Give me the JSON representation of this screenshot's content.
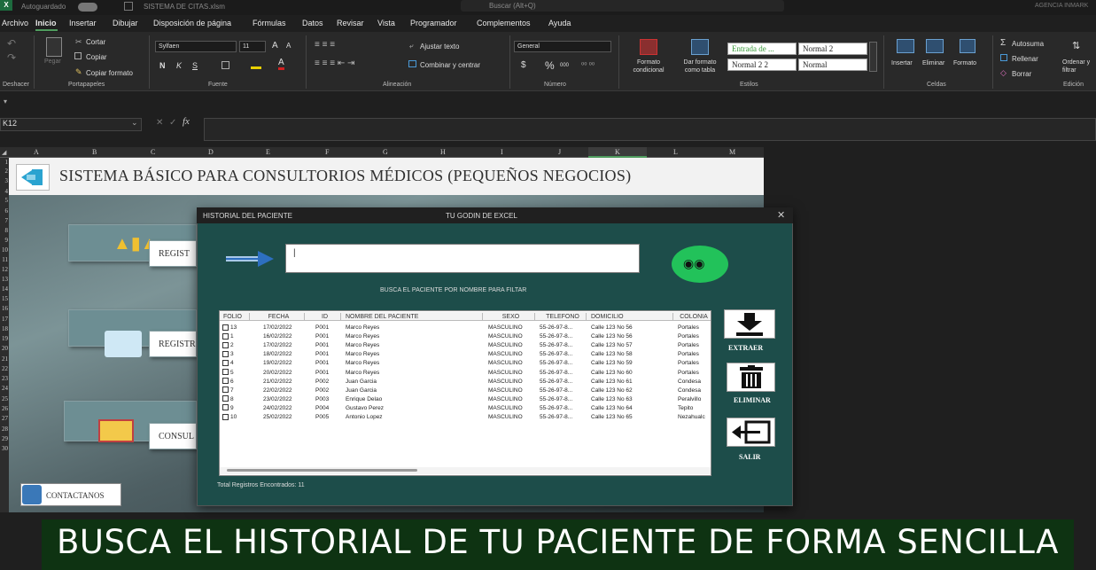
{
  "titlebar": {
    "autosave": "Autoguardado",
    "filename": "SISTEMA DE CITAS.xlsm",
    "search_placeholder": "Buscar (Alt+Q)",
    "account": "AGENCIA INMARK"
  },
  "menu": [
    "Archivo",
    "Inicio",
    "Insertar",
    "Dibujar",
    "Disposición de página",
    "Fórmulas",
    "Datos",
    "Revisar",
    "Vista",
    "Programador",
    "Complementos",
    "Ayuda"
  ],
  "ribbon": {
    "undo_group": "Deshacer",
    "clipboard": {
      "cut": "Cortar",
      "copy": "Copiar",
      "paste": "Pegar",
      "copy_format": "Copiar formato",
      "group": "Portapapeles"
    },
    "font": {
      "name": "Sylfaen",
      "size": "11",
      "bold": "N",
      "italic": "K",
      "underline": "S",
      "group": "Fuente"
    },
    "alignment": {
      "wrap": "Ajustar texto",
      "merge": "Combinar y centrar",
      "group": "Alineación"
    },
    "number": {
      "format": "General",
      "currency": "$",
      "percent": "%",
      "thousands": "000",
      "group": "Número"
    },
    "styles": {
      "cond_format": "Formato condicional",
      "as_table": "Dar formato como tabla",
      "style1": "Entrada de ...",
      "style2": "Normal 2",
      "style3": "Normal 2 2",
      "style4": "Normal",
      "group": "Estilos"
    },
    "cells": {
      "insert": "Insertar",
      "delete": "Eliminar",
      "format": "Formato",
      "group": "Celdas"
    },
    "editing": {
      "autosum": "Autosuma",
      "fill": "Rellenar",
      "clear": "Borrar",
      "sort": "Ordenar y filtrar",
      "group": "Edición"
    }
  },
  "formula_bar": {
    "cell_ref": "K12",
    "fx": "fx"
  },
  "columns": [
    "A",
    "B",
    "C",
    "D",
    "E",
    "F",
    "G",
    "H",
    "I",
    "J",
    "K",
    "L",
    "M"
  ],
  "rows": [
    "1",
    "2",
    "3",
    "4",
    "5",
    "6",
    "7",
    "8",
    "9",
    "10",
    "11",
    "12",
    "13",
    "14",
    "15",
    "16",
    "17",
    "18",
    "19",
    "20",
    "21",
    "22",
    "23",
    "24",
    "25",
    "26",
    "27",
    "28",
    "29",
    "30"
  ],
  "sheet": {
    "banner_title": "SISTEMA BÁSICO PARA CONSULTORIOS MÉDICOS (PEQUEÑOS NEGOCIOS)",
    "btn1": "REGIST",
    "btn2": "REGISTR",
    "btn3": "CONSUL",
    "contact": "CONTACTANOS"
  },
  "dialog": {
    "title": "HISTORIAL DEL PACIENTE",
    "center_title": "TU GODIN DE EXCEL",
    "search_value": "|",
    "search_hint": "BUSCA EL PACIENTE POR NOMBRE PARA FILTAR",
    "headers": [
      "FOLIO",
      "FECHA",
      "ID",
      "NOMBRE DEL PACIENTE",
      "SEXO",
      "TELEFONO",
      "DOMICILIO",
      "COLONIA"
    ],
    "rows": [
      [
        "13",
        "17/02/2022",
        "P001",
        "Marco Reyes",
        "MASCULINO",
        "55-26-97-8...",
        "Calle 123 No 56",
        "Portales"
      ],
      [
        "1",
        "16/02/2022",
        "P001",
        "Marco Reyes",
        "MASCULINO",
        "55-26-97-8...",
        "Calle 123 No 56",
        "Portales"
      ],
      [
        "2",
        "17/02/2022",
        "P001",
        "Marco Reyes",
        "MASCULINO",
        "55-26-97-8...",
        "Calle 123 No 57",
        "Portales"
      ],
      [
        "3",
        "18/02/2022",
        "P001",
        "Marco Reyes",
        "MASCULINO",
        "55-26-97-8...",
        "Calle 123 No 58",
        "Portales"
      ],
      [
        "4",
        "19/02/2022",
        "P001",
        "Marco Reyes",
        "MASCULINO",
        "55-26-97-8...",
        "Calle 123 No 59",
        "Portales"
      ],
      [
        "5",
        "20/02/2022",
        "P001",
        "Marco Reyes",
        "MASCULINO",
        "55-26-97-8...",
        "Calle 123 No 60",
        "Portales"
      ],
      [
        "6",
        "21/02/2022",
        "P002",
        "Juan Garcia",
        "MASCULINO",
        "55-26-97-8...",
        "Calle 123 No 61",
        "Condesa"
      ],
      [
        "7",
        "22/02/2022",
        "P002",
        "Juan Garcia",
        "MASCULINO",
        "55-26-97-8...",
        "Calle 123 No 62",
        "Condesa"
      ],
      [
        "8",
        "23/02/2022",
        "P003",
        "Enrique Delao",
        "MASCULINO",
        "55-26-97-8...",
        "Calle 123 No 63",
        "Peralvillo"
      ],
      [
        "9",
        "24/02/2022",
        "P004",
        "Gustavo Perez",
        "MASCULINO",
        "55-26-97-8...",
        "Calle 123 No 64",
        "Tepito"
      ],
      [
        "10",
        "25/02/2022",
        "P005",
        "Antonio Lopez",
        "MASCULINO",
        "55-26-97-8...",
        "Calle 123 No 65",
        "Nezahualc"
      ]
    ],
    "btn_extract": "EXTRAER",
    "btn_delete": "ELIMINAR",
    "btn_exit": "SALIR",
    "total": "Total Registros Encontrados: 11"
  },
  "caption": "BUSCA EL HISTORIAL DE TU PACIENTE DE FORMA SENCILLA"
}
